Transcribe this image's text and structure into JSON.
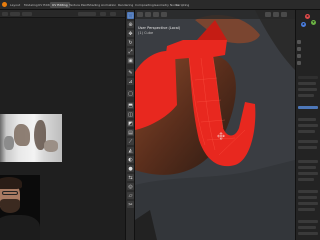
{
  "header": {
    "workspaces": [
      "Layout",
      "Modeling",
      "UV Editing",
      "Texture Paint",
      "Shading",
      "Animation",
      "Rendering",
      "Compositing",
      "Geometry Nodes",
      "Scripting"
    ],
    "active_workspace": "UV Editing"
  },
  "viewport": {
    "info_line1": "User Perspective (Local)",
    "info_line2": "(1) Cube"
  },
  "colors": {
    "accent": "#4d77b8",
    "mesh_red": "#e8281f",
    "blender_orange": "#e87d0d"
  }
}
